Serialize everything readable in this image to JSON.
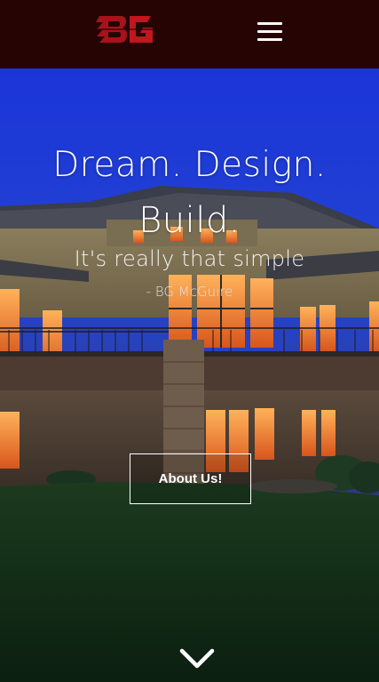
{
  "header": {
    "logo_text": "BG",
    "menu_icon": "hamburger-menu-icon",
    "background_color": "#260404",
    "logo_color": "#b0141a"
  },
  "hero": {
    "headline_line1": "Dream. Design.",
    "headline_line2": "Build.",
    "tagline": "It's really that simple",
    "attribution": "- BG McGuire",
    "cta_label": "About Us!",
    "scroll_icon": "chevron-down-icon"
  }
}
